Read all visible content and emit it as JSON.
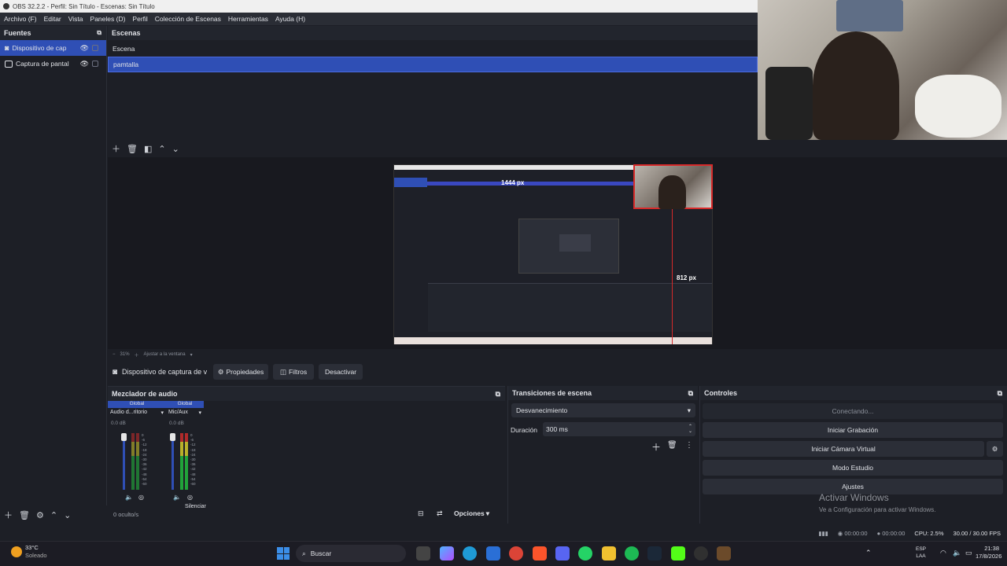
{
  "window": {
    "title": "OBS 32.2.2 - Perfil: Sin Título - Escenas: Sin Título"
  },
  "menu": [
    "Archivo (F)",
    "Editar",
    "Vista",
    "Paneles (D)",
    "Perfil",
    "Colección de Escenas",
    "Herramientas",
    "Ayuda (H)"
  ],
  "sources": {
    "title": "Fuentes",
    "items": [
      {
        "label": "Dispositivo de cap"
      },
      {
        "label": "Captura de pantal"
      }
    ]
  },
  "scenes": {
    "title": "Escenas",
    "items": [
      {
        "label": "Escena"
      },
      {
        "label": "pamtalla"
      }
    ]
  },
  "preview": {
    "width_label": "1444 px",
    "height_label": "812 px",
    "zoom": "31%",
    "fit_label": "Ajustar a la ventana"
  },
  "source_toolbar": {
    "source_name": "Dispositivo de captura de v",
    "properties": "Propiedades",
    "filters": "Filtros",
    "deactivate": "Desactivar"
  },
  "mixer": {
    "title": "Mezclador de audio",
    "channels": [
      {
        "badge": "Global",
        "name": "Audio d...ritorio",
        "db": "0.0 dB"
      },
      {
        "badge": "Global",
        "name": "Mic/Aux",
        "db": "0.0 dB"
      }
    ],
    "scale": [
      "0",
      "-6",
      "-12",
      "-18",
      "-24",
      "-30",
      "-36",
      "-42",
      "-48",
      "-54",
      "-60"
    ],
    "hidden": "0 oculto/s",
    "options": "Opciones",
    "tooltip": "Silenciar"
  },
  "transitions": {
    "title": "Transiciones de escena",
    "selected": "Desvanecimiento",
    "duration_label": "Duración",
    "duration_value": "300 ms"
  },
  "controls": {
    "title": "Controles",
    "connecting": "Conectando...",
    "record": "Iniciar Grabación",
    "virtual_cam": "Iniciar Cámara Virtual",
    "studio": "Modo Estudio",
    "settings": "Ajustes"
  },
  "watermark": {
    "line1": "Activar Windows",
    "line2": "Ve a Configuración para activar Windows."
  },
  "status": {
    "stream_time": "00:00:00",
    "rec_time": "00:00:00",
    "cpu": "CPU: 2.5%",
    "fps": "30.00 / 30.00 FPS"
  },
  "taskbar": {
    "temp": "33°C",
    "weather": "Soleado",
    "search": "Buscar",
    "lang1": "ESP",
    "lang2": "LAA",
    "time": "21:38",
    "date": "17/8/2026"
  },
  "colors": {
    "accent": "#2f4fb5",
    "bg": "#1d1f26",
    "panel": "#22252d",
    "red_rec": "#d62a2a"
  }
}
